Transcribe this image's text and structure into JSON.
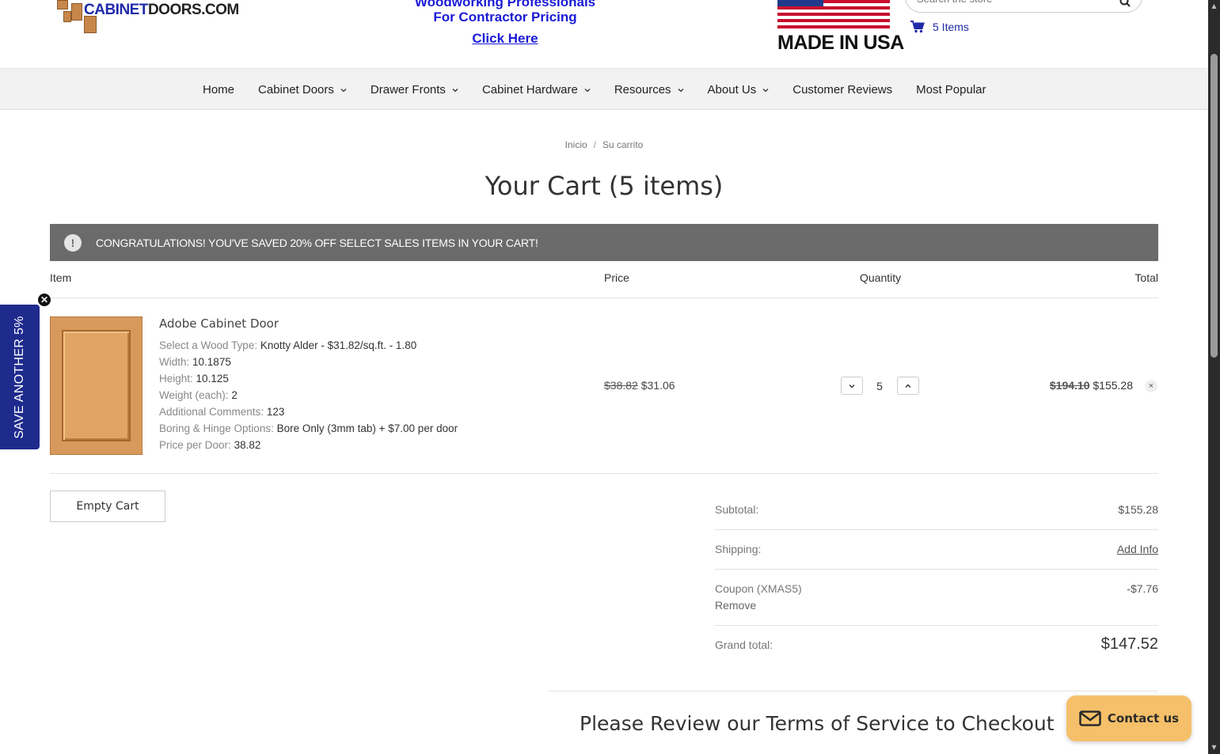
{
  "header": {
    "logo": {
      "brand_prefix": "CABINET",
      "brand_suffix": "DOORS.COM"
    },
    "promo": {
      "line1": "Woodworking Professionals",
      "line2": "For Contractor Pricing",
      "link": "Click Here"
    },
    "made_in_usa": "MADE IN USA",
    "search": {
      "placeholder": "Search the store"
    },
    "cart": {
      "label": "5 Items"
    }
  },
  "nav": {
    "items": [
      {
        "label": "Home",
        "dropdown": false
      },
      {
        "label": "Cabinet Doors",
        "dropdown": true
      },
      {
        "label": "Drawer Fronts",
        "dropdown": true
      },
      {
        "label": "Cabinet Hardware",
        "dropdown": true
      },
      {
        "label": "Resources",
        "dropdown": true
      },
      {
        "label": "About Us",
        "dropdown": true
      },
      {
        "label": "Customer Reviews",
        "dropdown": false
      },
      {
        "label": "Most Popular",
        "dropdown": false
      }
    ]
  },
  "breadcrumb": {
    "home": "Inicio",
    "separator": "/",
    "current": "Su carrito"
  },
  "page_title": "Your Cart (5 items)",
  "banner": {
    "message": "CONGRATULATIONS! YOU'VE SAVED 20% OFF SELECT SALES ITEMS IN YOUR CART!"
  },
  "table": {
    "headers": {
      "item": "Item",
      "price": "Price",
      "quantity": "Quantity",
      "total": "Total"
    }
  },
  "cart_item": {
    "name": "Adobe Cabinet Door",
    "options": [
      {
        "key": "Select a Wood Type:",
        "value": "Knotty Alder - $31.82/sq.ft. - 1.80"
      },
      {
        "key": "Width:",
        "value": "10.1875"
      },
      {
        "key": "Height:",
        "value": "10.125"
      },
      {
        "key": "Weight (each):",
        "value": "2"
      },
      {
        "key": "Additional Comments:",
        "value": "123"
      },
      {
        "key": "Boring & Hinge Options:",
        "value": "Bore Only (3mm tab) + $7.00 per door"
      },
      {
        "key": "Price per Door:",
        "value": "38.82"
      }
    ],
    "price_original": "$38.82",
    "price_sale": "$31.06",
    "quantity": "5",
    "total_original": "$194.10",
    "total_sale": "$155.28",
    "remove_icon": "×"
  },
  "empty_cart_label": "Empty Cart",
  "totals": {
    "subtotal_label": "Subtotal:",
    "subtotal_value": "$155.28",
    "shipping_label": "Shipping:",
    "shipping_value": "Add Info",
    "coupon_label": "Coupon (XMAS5)",
    "coupon_remove": "Remove",
    "coupon_value": "-$7.76",
    "grand_label": "Grand total:",
    "grand_value": "$147.52"
  },
  "terms_heading": "Please Review our Terms of Service to Checkout",
  "side_tab": {
    "label": "SAVE ANOTHER 5%",
    "close": "✕"
  },
  "contact": {
    "label": "Contact us"
  },
  "colors": {
    "brand_blue": "#1e2aa8",
    "side_tab": "#1e2a8c",
    "banner_bg": "#6b6b6b",
    "contact_bg": "#f5c069"
  }
}
